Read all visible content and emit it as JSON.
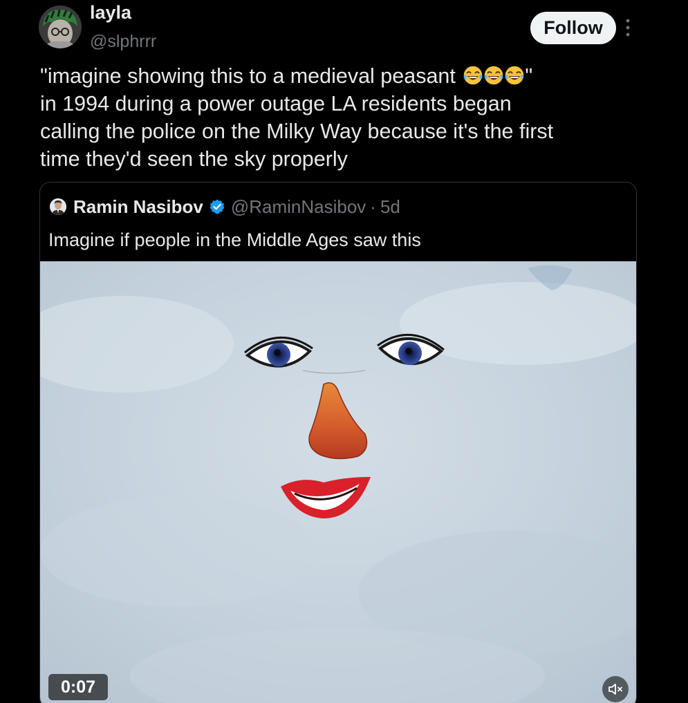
{
  "post": {
    "author_name": "layla",
    "author_handle": "@slphrrr",
    "follow_label": "Follow",
    "text_lines": [
      "\"imagine showing this to a medieval peasant",
      "\"",
      "in 1994 during a power outage LA residents began",
      "calling the police on the Milky Way because it's the first",
      "time they'd seen the sky properly"
    ],
    "emojis": [
      "face-with-tears-of-joy",
      "face-with-tears-of-joy",
      "face-with-tears-of-joy"
    ]
  },
  "quote": {
    "author_name": "Ramin Nasibov",
    "author_handle": "@RaminNasibov",
    "separator": "·",
    "time": "5d",
    "text": "Imagine if people in the Middle Ages saw this",
    "video_duration": "0:07"
  },
  "colors": {
    "background": "#000000",
    "primary_text": "#e7e9ea",
    "secondary_text": "#71767b",
    "follow_button_bg": "#eff3f4",
    "verified_blue": "#1d9bf0",
    "border": "#2f3336",
    "sky": "#c5d2dd"
  },
  "icons": {
    "more": "more-vertical-icon",
    "verified": "verified-badge-icon",
    "mute": "speaker-muted-icon"
  }
}
